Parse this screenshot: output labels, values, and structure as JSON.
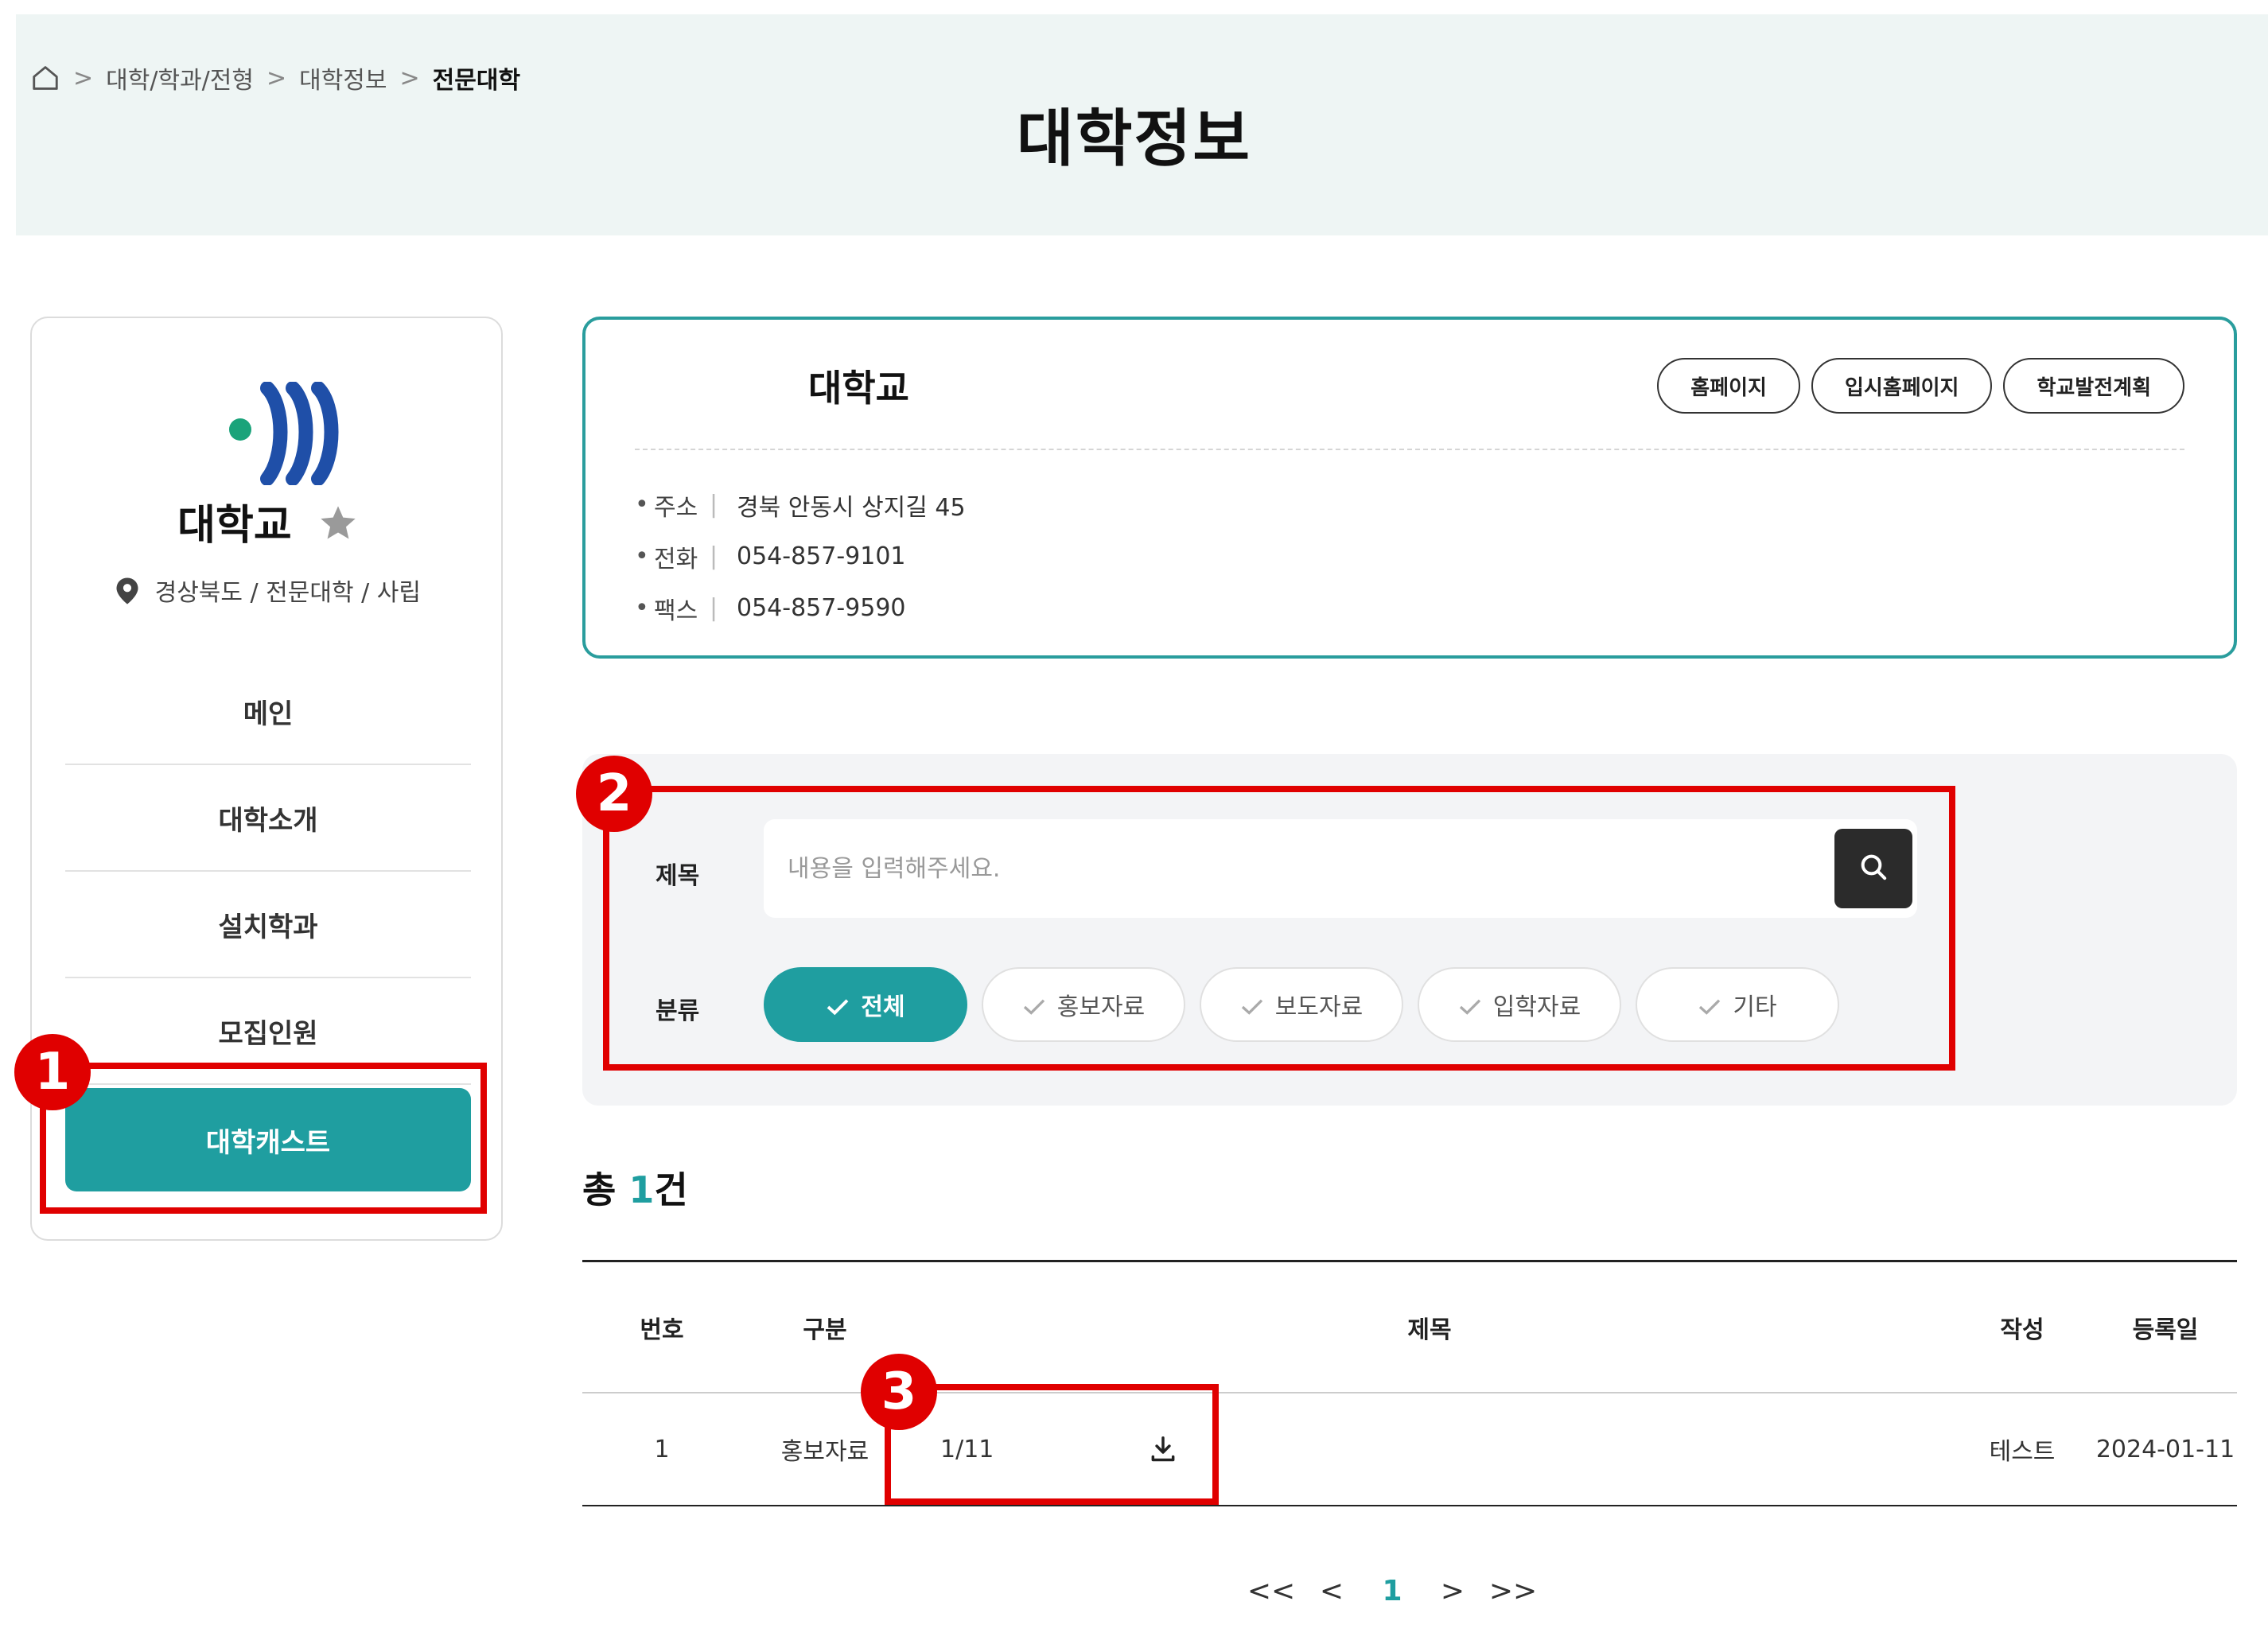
{
  "breadcrumb": {
    "items": [
      "대학/학과/전형",
      "대학정보"
    ],
    "current": "전문대학",
    "separator": ">"
  },
  "page": {
    "title": "대학정보"
  },
  "sidebar": {
    "university_name": "대학교",
    "meta": "경상북도 / 전문대학 / 사립",
    "menu": [
      "메인",
      "대학소개",
      "설치학과",
      "모집인원",
      "대학캐스트"
    ],
    "active_index": 4
  },
  "info": {
    "title": "대학교",
    "buttons": [
      "홈페이지",
      "입시홈페이지",
      "학교발전계획"
    ],
    "rows": [
      {
        "label": "주소",
        "value": "경북 안동시 상지길 45"
      },
      {
        "label": "전화",
        "value": "054-857-9101"
      },
      {
        "label": "팩스",
        "value": "054-857-9590"
      }
    ]
  },
  "search": {
    "title_label": "제목",
    "placeholder": "내용을 입력해주세요.",
    "category_label": "분류",
    "chips": [
      "전체",
      "홍보자료",
      "보도자료",
      "입학자료",
      "기타"
    ],
    "active_chip": 0
  },
  "total": {
    "prefix": "총 ",
    "count": "1",
    "suffix": "건"
  },
  "table": {
    "headers": [
      "번호",
      "구분",
      "제목",
      "작성",
      "등록일"
    ],
    "rows": [
      {
        "no": "1",
        "category": "홍보자료",
        "title": "1/11",
        "author": "테스트",
        "date": "2024-01-11"
      }
    ]
  },
  "pagination": {
    "first": "<<",
    "prev": "<",
    "current": "1",
    "next": ">",
    "last": ">>"
  },
  "annotations": [
    "1",
    "2",
    "3"
  ],
  "colors": {
    "accent": "#1f9ea0",
    "annotation": "#e00000",
    "header_band": "#eef5f4",
    "search_button": "#2b2b2b"
  }
}
